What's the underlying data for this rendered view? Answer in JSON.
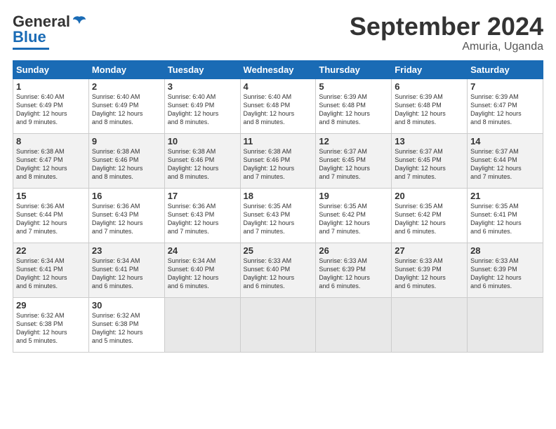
{
  "logo": {
    "text_general": "General",
    "text_blue": "Blue"
  },
  "title": "September 2024",
  "location": "Amuria, Uganda",
  "days_of_week": [
    "Sunday",
    "Monday",
    "Tuesday",
    "Wednesday",
    "Thursday",
    "Friday",
    "Saturday"
  ],
  "weeks": [
    [
      {
        "day": "1",
        "lines": [
          "Sunrise: 6:40 AM",
          "Sunset: 6:49 PM",
          "Daylight: 12 hours",
          "and 9 minutes."
        ]
      },
      {
        "day": "2",
        "lines": [
          "Sunrise: 6:40 AM",
          "Sunset: 6:49 PM",
          "Daylight: 12 hours",
          "and 8 minutes."
        ]
      },
      {
        "day": "3",
        "lines": [
          "Sunrise: 6:40 AM",
          "Sunset: 6:49 PM",
          "Daylight: 12 hours",
          "and 8 minutes."
        ]
      },
      {
        "day": "4",
        "lines": [
          "Sunrise: 6:40 AM",
          "Sunset: 6:48 PM",
          "Daylight: 12 hours",
          "and 8 minutes."
        ]
      },
      {
        "day": "5",
        "lines": [
          "Sunrise: 6:39 AM",
          "Sunset: 6:48 PM",
          "Daylight: 12 hours",
          "and 8 minutes."
        ]
      },
      {
        "day": "6",
        "lines": [
          "Sunrise: 6:39 AM",
          "Sunset: 6:48 PM",
          "Daylight: 12 hours",
          "and 8 minutes."
        ]
      },
      {
        "day": "7",
        "lines": [
          "Sunrise: 6:39 AM",
          "Sunset: 6:47 PM",
          "Daylight: 12 hours",
          "and 8 minutes."
        ]
      }
    ],
    [
      {
        "day": "8",
        "lines": [
          "Sunrise: 6:38 AM",
          "Sunset: 6:47 PM",
          "Daylight: 12 hours",
          "and 8 minutes."
        ]
      },
      {
        "day": "9",
        "lines": [
          "Sunrise: 6:38 AM",
          "Sunset: 6:46 PM",
          "Daylight: 12 hours",
          "and 8 minutes."
        ]
      },
      {
        "day": "10",
        "lines": [
          "Sunrise: 6:38 AM",
          "Sunset: 6:46 PM",
          "Daylight: 12 hours",
          "and 8 minutes."
        ]
      },
      {
        "day": "11",
        "lines": [
          "Sunrise: 6:38 AM",
          "Sunset: 6:46 PM",
          "Daylight: 12 hours",
          "and 7 minutes."
        ]
      },
      {
        "day": "12",
        "lines": [
          "Sunrise: 6:37 AM",
          "Sunset: 6:45 PM",
          "Daylight: 12 hours",
          "and 7 minutes."
        ]
      },
      {
        "day": "13",
        "lines": [
          "Sunrise: 6:37 AM",
          "Sunset: 6:45 PM",
          "Daylight: 12 hours",
          "and 7 minutes."
        ]
      },
      {
        "day": "14",
        "lines": [
          "Sunrise: 6:37 AM",
          "Sunset: 6:44 PM",
          "Daylight: 12 hours",
          "and 7 minutes."
        ]
      }
    ],
    [
      {
        "day": "15",
        "lines": [
          "Sunrise: 6:36 AM",
          "Sunset: 6:44 PM",
          "Daylight: 12 hours",
          "and 7 minutes."
        ]
      },
      {
        "day": "16",
        "lines": [
          "Sunrise: 6:36 AM",
          "Sunset: 6:43 PM",
          "Daylight: 12 hours",
          "and 7 minutes."
        ]
      },
      {
        "day": "17",
        "lines": [
          "Sunrise: 6:36 AM",
          "Sunset: 6:43 PM",
          "Daylight: 12 hours",
          "and 7 minutes."
        ]
      },
      {
        "day": "18",
        "lines": [
          "Sunrise: 6:35 AM",
          "Sunset: 6:43 PM",
          "Daylight: 12 hours",
          "and 7 minutes."
        ]
      },
      {
        "day": "19",
        "lines": [
          "Sunrise: 6:35 AM",
          "Sunset: 6:42 PM",
          "Daylight: 12 hours",
          "and 7 minutes."
        ]
      },
      {
        "day": "20",
        "lines": [
          "Sunrise: 6:35 AM",
          "Sunset: 6:42 PM",
          "Daylight: 12 hours",
          "and 6 minutes."
        ]
      },
      {
        "day": "21",
        "lines": [
          "Sunrise: 6:35 AM",
          "Sunset: 6:41 PM",
          "Daylight: 12 hours",
          "and 6 minutes."
        ]
      }
    ],
    [
      {
        "day": "22",
        "lines": [
          "Sunrise: 6:34 AM",
          "Sunset: 6:41 PM",
          "Daylight: 12 hours",
          "and 6 minutes."
        ]
      },
      {
        "day": "23",
        "lines": [
          "Sunrise: 6:34 AM",
          "Sunset: 6:41 PM",
          "Daylight: 12 hours",
          "and 6 minutes."
        ]
      },
      {
        "day": "24",
        "lines": [
          "Sunrise: 6:34 AM",
          "Sunset: 6:40 PM",
          "Daylight: 12 hours",
          "and 6 minutes."
        ]
      },
      {
        "day": "25",
        "lines": [
          "Sunrise: 6:33 AM",
          "Sunset: 6:40 PM",
          "Daylight: 12 hours",
          "and 6 minutes."
        ]
      },
      {
        "day": "26",
        "lines": [
          "Sunrise: 6:33 AM",
          "Sunset: 6:39 PM",
          "Daylight: 12 hours",
          "and 6 minutes."
        ]
      },
      {
        "day": "27",
        "lines": [
          "Sunrise: 6:33 AM",
          "Sunset: 6:39 PM",
          "Daylight: 12 hours",
          "and 6 minutes."
        ]
      },
      {
        "day": "28",
        "lines": [
          "Sunrise: 6:33 AM",
          "Sunset: 6:39 PM",
          "Daylight: 12 hours",
          "and 6 minutes."
        ]
      }
    ],
    [
      {
        "day": "29",
        "lines": [
          "Sunrise: 6:32 AM",
          "Sunset: 6:38 PM",
          "Daylight: 12 hours",
          "and 5 minutes."
        ]
      },
      {
        "day": "30",
        "lines": [
          "Sunrise: 6:32 AM",
          "Sunset: 6:38 PM",
          "Daylight: 12 hours",
          "and 5 minutes."
        ]
      },
      {
        "day": "",
        "lines": []
      },
      {
        "day": "",
        "lines": []
      },
      {
        "day": "",
        "lines": []
      },
      {
        "day": "",
        "lines": []
      },
      {
        "day": "",
        "lines": []
      }
    ]
  ]
}
